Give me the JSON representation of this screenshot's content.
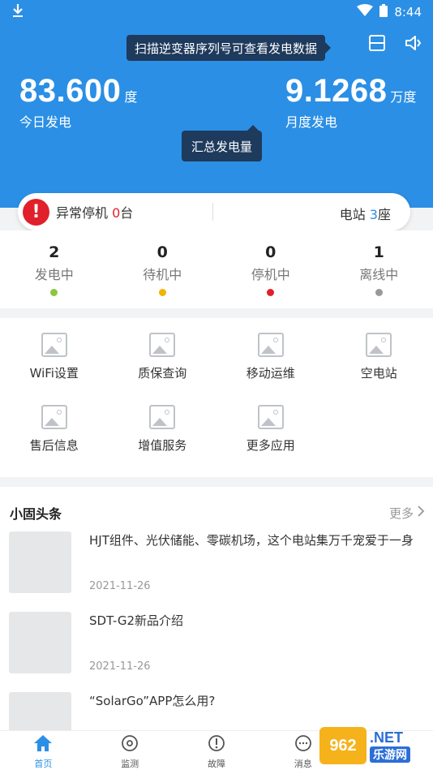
{
  "status_bar": {
    "time": "8:44"
  },
  "header": {
    "tooltip_scan": "扫描逆变器序列号可查看发电数据",
    "tooltip_summary": "汇总发电量",
    "today": {
      "value": "83.600",
      "unit": "度",
      "label": "今日发电"
    },
    "month": {
      "value": "9.1268",
      "unit": "万度",
      "label": "月度发电"
    }
  },
  "alert_bar": {
    "icon_glyph": "!",
    "abnormal_label": "异常停机",
    "abnormal_count": "0",
    "abnormal_unit": "台",
    "station_label": "电站",
    "station_count": "3",
    "station_unit": "座"
  },
  "statuses": [
    {
      "count": "2",
      "label": "发电中",
      "color": "#8cc63f"
    },
    {
      "count": "0",
      "label": "待机中",
      "color": "#f5b300"
    },
    {
      "count": "0",
      "label": "停机中",
      "color": "#e0202a"
    },
    {
      "count": "1",
      "label": "离线中",
      "color": "#999999"
    }
  ],
  "grid": [
    {
      "label": "WiFi设置"
    },
    {
      "label": "质保查询"
    },
    {
      "label": "移动运维"
    },
    {
      "label": "空电站"
    },
    {
      "label": "售后信息"
    },
    {
      "label": "增值服务"
    },
    {
      "label": "更多应用"
    }
  ],
  "news": {
    "title": "小固头条",
    "more": "更多",
    "articles": [
      {
        "title": "HJT组件、光伏储能、零碳机场，这个电站集万千宠爱于一身",
        "date": "2021-11-26"
      },
      {
        "title": "SDT-G2新品介绍",
        "date": "2021-11-26"
      },
      {
        "title": "“SolarGo”APP怎么用?",
        "date": ""
      }
    ]
  },
  "tabs": [
    {
      "label": "首页",
      "icon": "home-icon",
      "active": true
    },
    {
      "label": "监测",
      "icon": "monitor-icon",
      "active": false
    },
    {
      "label": "故障",
      "icon": "fault-icon",
      "active": false
    },
    {
      "label": "消息",
      "icon": "message-icon",
      "active": false
    }
  ],
  "watermark": {
    "badge": "962",
    "net": ".NET",
    "cn": "乐游网"
  },
  "colors": {
    "primary": "#2b8fe5",
    "danger": "#e0202a",
    "tooltip_bg": "#1e3a5c"
  }
}
